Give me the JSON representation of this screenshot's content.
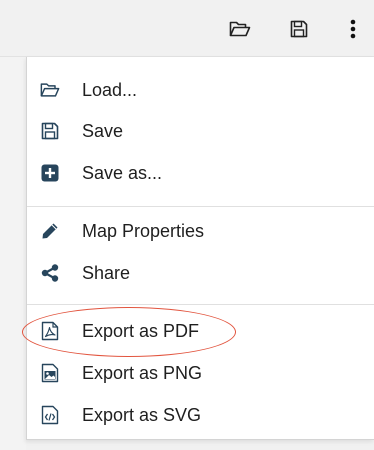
{
  "toolbar": {
    "open_icon": "folder-open-icon",
    "save_icon": "floppy-disk-icon",
    "more_icon": "vertical-ellipsis-icon"
  },
  "menu": {
    "items": [
      {
        "label": "Load...",
        "icon": "folder-open-icon"
      },
      {
        "label": "Save",
        "icon": "floppy-disk-icon"
      },
      {
        "label": "Save as...",
        "icon": "plus-square-icon"
      },
      {
        "label": "Map Properties",
        "icon": "pencil-icon"
      },
      {
        "label": "Share",
        "icon": "share-icon"
      },
      {
        "label": "Export as PDF",
        "icon": "pdf-file-icon"
      },
      {
        "label": "Export as PNG",
        "icon": "image-file-icon"
      },
      {
        "label": "Export as SVG",
        "icon": "code-file-icon"
      }
    ]
  },
  "annotation": {
    "highlight_color": "#e2553f"
  },
  "colors": {
    "icon_dark": "#27455c",
    "text": "#1f1f1f"
  }
}
